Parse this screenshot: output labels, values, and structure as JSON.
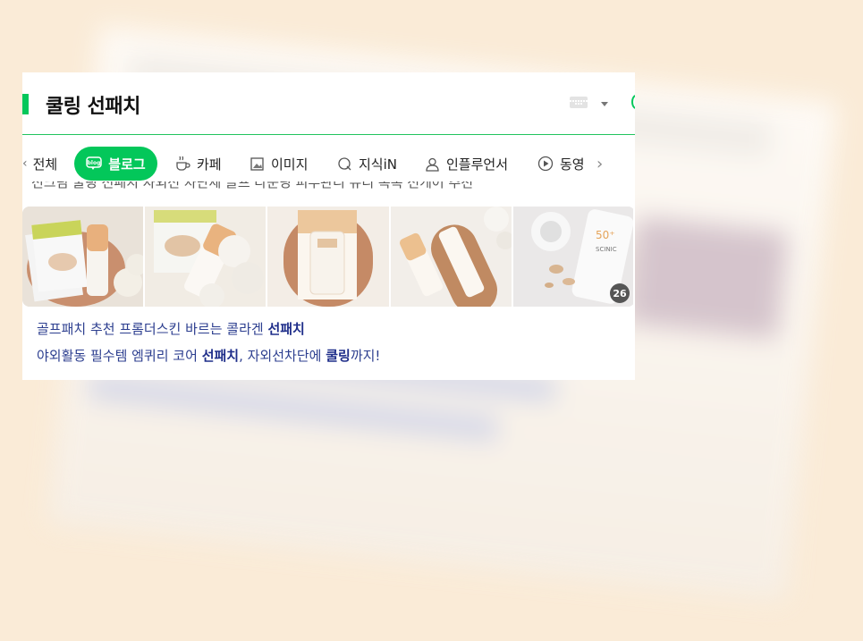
{
  "header": {
    "title": "쿨링 선패치",
    "keyboard_icon": "keyboard-icon",
    "dropdown_icon": "caret-down-icon"
  },
  "tabs": [
    {
      "label": "전체",
      "icon": "chevron-left-icon"
    },
    {
      "label": "블로그",
      "icon": "blog-icon",
      "active": true
    },
    {
      "label": "카페",
      "icon": "cafe-icon"
    },
    {
      "label": "이미지",
      "icon": "image-icon"
    },
    {
      "label": "지식iN",
      "icon": "kin-icon"
    },
    {
      "label": "인플루언서",
      "icon": "person-icon"
    },
    {
      "label": "동영",
      "icon": "play-icon"
    }
  ],
  "tabs_next_icon": "chevron-right-icon",
  "cut_text": "선크림 쿨링 선패치 자외선 차단제 골프 라운딩 피부관리 유리 촉촉 선케어 추천",
  "thumbnails": {
    "count_badge": "26"
  },
  "snippet_1": {
    "text": "골프패치 추천 프롬더스킨 바르는 콜라겐 ",
    "highlight": "선패치"
  },
  "snippet_2": {
    "prefix": "야외활동 필수템 엠퀴리 코어 ",
    "highlight1": "선패치",
    "middle": ", 자외선차단에 ",
    "highlight2": "쿨링",
    "suffix": "까지!"
  },
  "colors": {
    "accent": "#03c75a",
    "link": "#2c3e8f",
    "background": "#faebd7"
  }
}
